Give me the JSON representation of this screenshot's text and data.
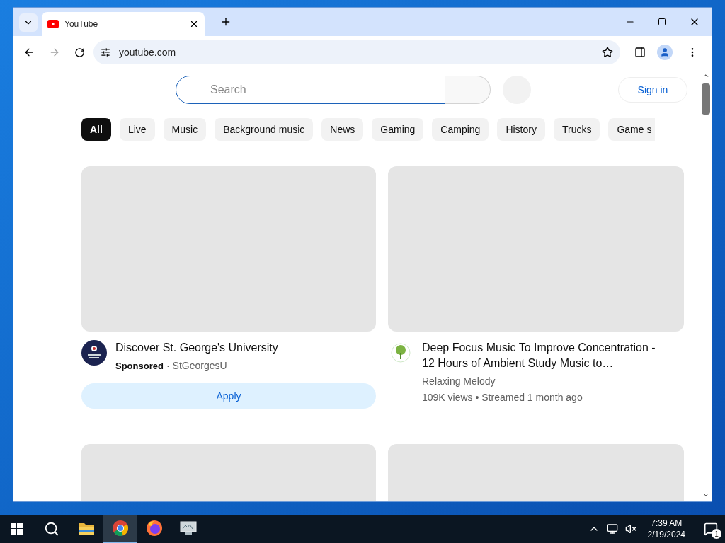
{
  "browser": {
    "tab": {
      "title": "YouTube"
    },
    "address": "youtube.com"
  },
  "header": {
    "search": {
      "placeholder": "Search"
    },
    "sign_in": "Sign in"
  },
  "chips": [
    {
      "label": "All",
      "selected": true
    },
    {
      "label": "Live",
      "selected": false
    },
    {
      "label": "Music",
      "selected": false
    },
    {
      "label": "Background music",
      "selected": false
    },
    {
      "label": "News",
      "selected": false
    },
    {
      "label": "Gaming",
      "selected": false
    },
    {
      "label": "Camping",
      "selected": false
    },
    {
      "label": "History",
      "selected": false
    },
    {
      "label": "Trucks",
      "selected": false
    },
    {
      "label": "Game s",
      "selected": false
    }
  ],
  "cards": [
    {
      "kind": "ad",
      "title": "Discover St. George's University",
      "label": "Sponsored",
      "separator": "·",
      "channel": "StGeorgesU",
      "button": "Apply"
    },
    {
      "kind": "video",
      "title": "Deep Focus Music To Improve Concentration - 12 Hours of Ambient Study Music to…",
      "channel": "Relaxing Melody",
      "meta": "109K views • Streamed 1 month ago"
    }
  ],
  "taskbar": {
    "apps": [
      {
        "kind": "folder",
        "selected": false
      },
      {
        "kind": "chrome",
        "selected": true
      },
      {
        "kind": "firefox",
        "selected": false
      },
      {
        "kind": "monitor",
        "selected": false
      }
    ],
    "time": "7:39 AM",
    "date": "2/19/2024",
    "notifications": "1"
  }
}
